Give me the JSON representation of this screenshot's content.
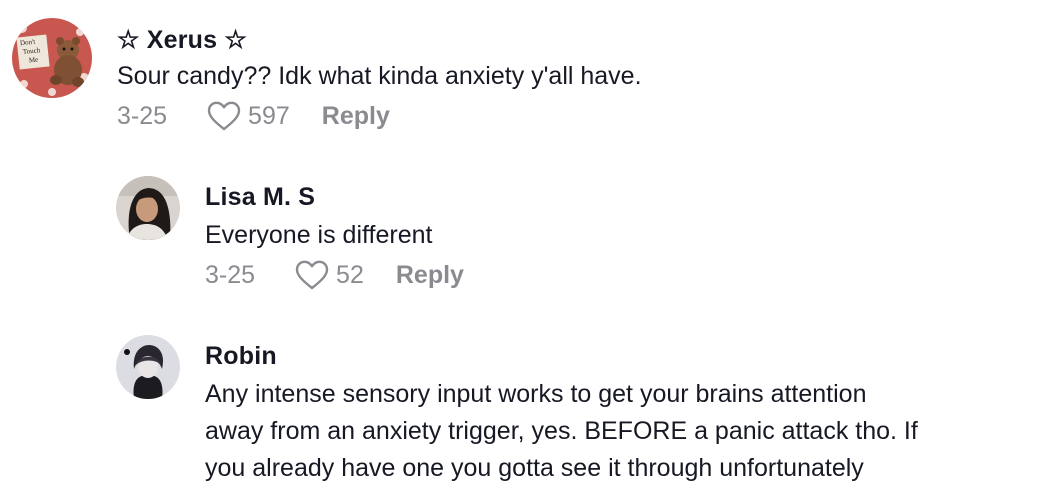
{
  "comments": [
    {
      "username": "☆ Xerus ☆",
      "text": "Sour candy?? Idk what kinda anxiety y'all have.",
      "date": "3-25",
      "likes": "597",
      "reply_label": "Reply",
      "avatar_text": [
        "Don't",
        "Touch",
        "Me"
      ]
    },
    {
      "username": "Lisa M. S",
      "text": "Everyone is different",
      "date": "3-25",
      "likes": "52",
      "reply_label": "Reply"
    },
    {
      "username": "Robin",
      "text_lines": [
        "Any intense sensory input works to get your brains attention",
        "away from an anxiety trigger, yes. BEFORE a panic attack tho. If",
        "you already have one you gotta see it through unfortunately"
      ]
    }
  ],
  "colors": {
    "text": "#161823",
    "secondary": "#8a8b91"
  },
  "icons": {
    "like": "heart-outline-icon"
  }
}
